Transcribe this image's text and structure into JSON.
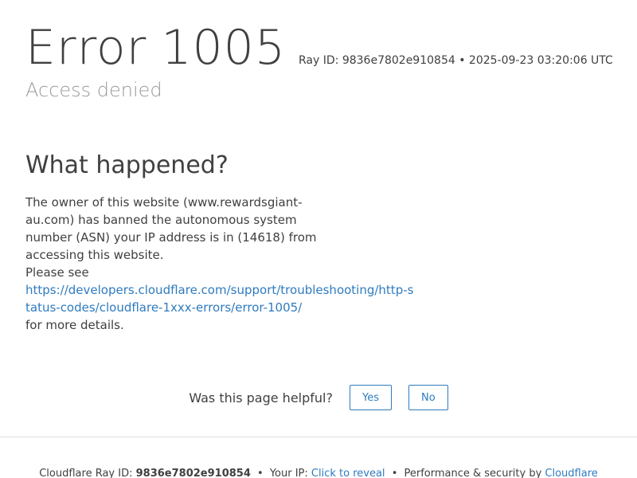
{
  "header": {
    "error_word": "Error",
    "error_code": "1005",
    "ray_info": "Ray ID: 9836e7802e910854 • 2025-09-23 03:20:06 UTC",
    "subtitle": "Access denied"
  },
  "main": {
    "heading": "What happened?",
    "description": "The owner of this website (www.rewardsgiant-au.com) has banned the autonomous system number (ASN) your IP address is in (14618) from accessing this website.",
    "please_see": "Please see",
    "link_text": "https://developers.cloudflare.com/support/troubleshooting/http-status-codes/cloudflare-1xxx-errors/error-1005/",
    "details": "for more details."
  },
  "feedback": {
    "question": "Was this page helpful?",
    "yes_label": "Yes",
    "no_label": "No"
  },
  "footer": {
    "ray_label": "Cloudflare Ray ID:",
    "ray_id": "9836e7802e910854",
    "ip_label": "Your IP:",
    "ip_link": "Click to reveal",
    "perf_label": "Performance & security by",
    "perf_link": "Cloudflare",
    "separator": "•"
  },
  "colors": {
    "text": "#404040",
    "muted": "#999999",
    "link": "#2f7bbf",
    "divider": "#dedede"
  }
}
